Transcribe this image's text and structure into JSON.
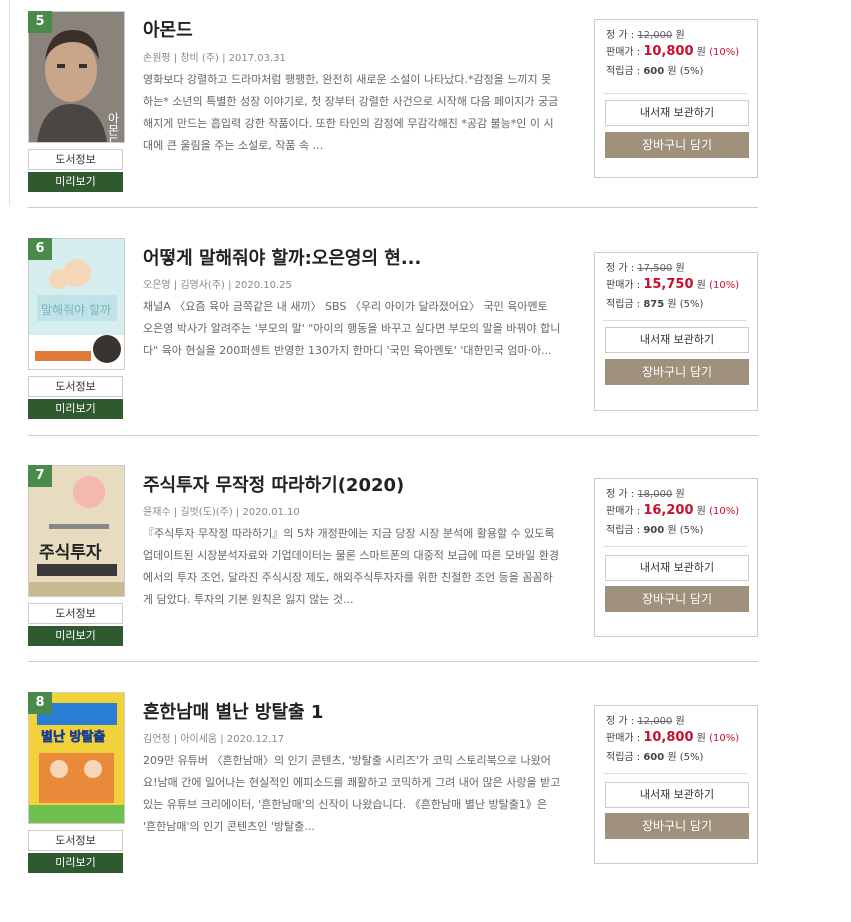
{
  "labels": {
    "book_info": "도서정보",
    "preview": "미리보기",
    "list_price": "정 가 : ",
    "sale_price": "판매가 : ",
    "points": "적립금 : ",
    "won": " 원",
    "add_shelf": "내서재 보관하기",
    "add_cart": "장바구니 담기"
  },
  "books": [
    {
      "rank": "5",
      "title": "아몬드",
      "meta": "손원평 | 창비 (주) | 2017.03.31",
      "desc": "영화보다 강렬하고 드라마처럼 팽팽한, 완전히 새로운 소설이 나타났다.*감정을 느끼지 못하는* 소년의 특별한 성장 이야기로, 첫 장부터 강렬한 사건으로 시작해 다음 페이지가 궁금해지게 만드는 흡입력 강한 작품이다. 또한 타인의 감정에 무감각해진 *공감 불능*인 이 시대에 큰 울림을 주는 소설로, 작품 속 ...",
      "list_price": "12,000",
      "sale_price": "10,800",
      "discount": "(10%)",
      "points": "600",
      "points_rate": "(5%)",
      "cover_bg": "#6b6560",
      "cover_text": "아몬드"
    },
    {
      "rank": "6",
      "title": "어떻게 말해줘야 할까:오은영의 현...",
      "meta": "오은영 | 김영사(주) | 2020.10.25",
      "desc": "채널A 〈요즘 육아 금쪽같은 내 새끼〉 SBS 〈우리 아이가 달라졌어요〉 국민 육아멘토 오은영 박사가 알려주는 '부모의 말' \"아이의 행동을 바꾸고 싶다면 부모의 말을 바꿔야 합니다\" 육아 현실을 200퍼센트 반영한 130가지 한마디 '국민 육아멘토' '대한민국 엄마·아...",
      "list_price": "17,500",
      "sale_price": "15,750",
      "discount": "(10%)",
      "points": "875",
      "points_rate": "(5%)",
      "cover_bg": "#bfe3e6",
      "cover_text": "말해줘야 할까"
    },
    {
      "rank": "7",
      "title": "주식투자 무작정 따라하기(2020)",
      "meta": "윤재수 | 길벗(도)(주) | 2020.01.10",
      "desc": "『주식투자 무작정 따라하기』의 5차 개정판에는 지금 당장 시장 분석에 활용할 수 있도록 업데이트된 시장분석자료와 기업데이터는 물론 스마트폰의 대중적 보급에 따른 모바일 환경에서의 투자 조언, 달라진 주식시장 제도, 해외주식투자자를 위한 친절한 조언 등을 꼼꼼하게 담았다. 투자의 기본 원칙은 잃지 않는 것...",
      "list_price": "18,000",
      "sale_price": "16,200",
      "discount": "(10%)",
      "points": "900",
      "points_rate": "(5%)",
      "cover_bg": "#d9c9a3",
      "cover_text": "주식투자"
    },
    {
      "rank": "8",
      "title": "흔한남매 별난 방탈출 1",
      "meta": "김언정 | 아이세움 | 2020.12.17",
      "desc": "209만 유튜버 〈흔한남매〉의 인기 콘텐츠, '방탈출 시리즈'가 코믹 스토리북으로 나왔어요!남매 간에 일어나는 현실적인 에피소드를 쾌활하고 코믹하게 그려 내어 많은 사랑을 받고 있는 유튜브 크리에이터, '흔한남매'의 신작이 나왔습니다. 《흔한남매 별난 방탈출1》은 '흔한남매'의 인기 콘텐츠인 '방탈출...",
      "list_price": "12,000",
      "sale_price": "10,800",
      "discount": "(10%)",
      "points": "600",
      "points_rate": "(5%)",
      "cover_bg": "#f2d23a",
      "cover_text": "별난 방탈출"
    }
  ]
}
